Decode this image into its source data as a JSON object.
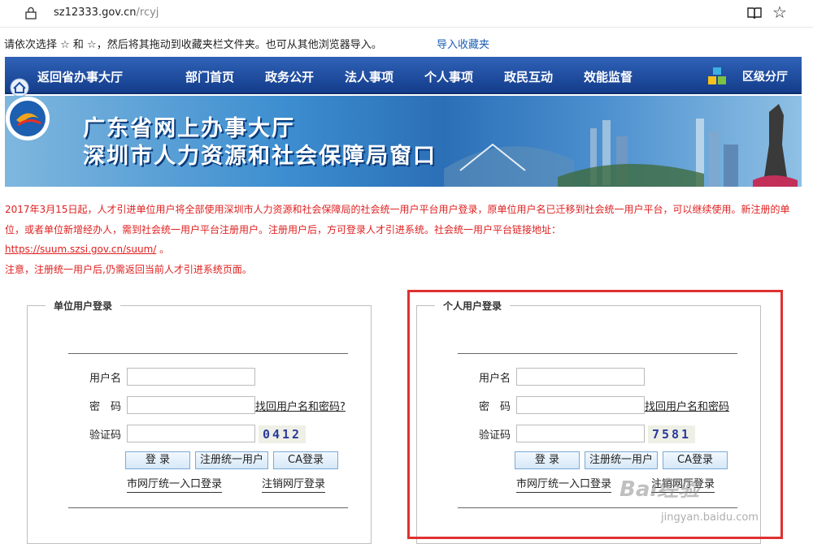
{
  "browser": {
    "url_host": "sz12333.gov.cn",
    "url_path": "/rcyj"
  },
  "favbar": {
    "text": "请依次选择 ☆ 和 ☆，然后将其拖动到收藏夹栏文件夹。也可从其他浏览器导入。",
    "import_label": "导入收藏夹"
  },
  "nav": {
    "back": "返回省办事大厅",
    "items": [
      "部门首页",
      "政务公开",
      "法人事项",
      "个人事项",
      "政民互动",
      "效能监督"
    ],
    "right": "区级分厅"
  },
  "banner": {
    "title1": "广东省网上办事大厅",
    "title2": "深圳市人力资源和社会保障局窗口"
  },
  "notice": {
    "line1": "2017年3月15日起，人才引进单位用户将全部使用深圳市人力资源和社会保障局的社会统一用户平台用户登录，原单位用户名已迁移到社会统一用户平台，可以继续使用。新注册的单位，或者单位新增经办人，需到社会统一用户平台注册用户。注册用户后，方可登录人才引进系统。社会统一用户平台链接地址：",
    "link": "https://suum.szsi.gov.cn/suum/",
    "link_suffix": "。",
    "line2": "注意，注册统一用户后,仍需返回当前人才引进系统页面。"
  },
  "unit_login": {
    "title": "单位用户登录",
    "username_label": "用户名",
    "password_label": "密　码",
    "captcha_label": "验证码",
    "find_link": "找回用户名和密码?",
    "captcha_value": "0412",
    "login_btn": "登 录",
    "register_btn": "注册统一用户",
    "ca_btn": "CA登录",
    "city_link": "市网厅统一入口登录",
    "cancel_link": "注销网厅登录"
  },
  "personal_login": {
    "title": "个人用户登录",
    "username_label": "用户名",
    "password_label": "密　码",
    "captcha_label": "验证码",
    "find_link": "找回用户名和密码",
    "captcha_value": "7581",
    "login_btn": "登 录",
    "register_btn": "注册统一用户",
    "ca_btn": "CA登录",
    "city_link": "市网厅统一入口登录",
    "cancel_link": "注销网厅登录"
  },
  "watermark": {
    "brand": "Bai经验",
    "url": "jingyan.baidu.com"
  },
  "colors": {
    "nav_blue": "#1f4fa3",
    "notice_red": "#e02020",
    "highlight_red": "#e03030"
  }
}
